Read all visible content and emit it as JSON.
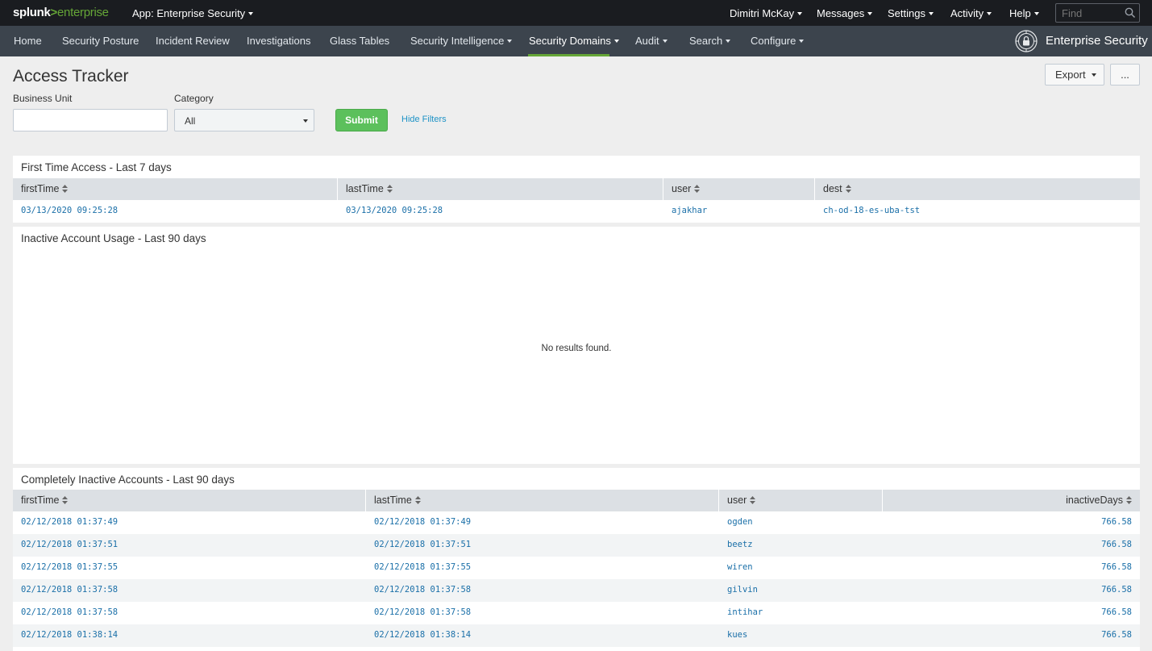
{
  "topbar": {
    "logo_splunk": "splunk",
    "logo_gt": ">",
    "logo_enterprise": "enterprise",
    "app_label": "App: Enterprise Security",
    "menus": [
      "Dimitri McKay",
      "Messages",
      "Settings",
      "Activity",
      "Help"
    ],
    "find_placeholder": "Find"
  },
  "nav": {
    "items": [
      "Home",
      "Security Posture",
      "Incident Review",
      "Investigations",
      "Glass Tables",
      "Security Intelligence",
      "Security Domains",
      "Audit",
      "Search",
      "Configure"
    ],
    "active": "Security Domains",
    "brand": "Enterprise Security"
  },
  "page": {
    "title": "Access Tracker",
    "export_label": "Export",
    "more_label": "..."
  },
  "filters": {
    "business_unit_label": "Business Unit",
    "business_unit_value": "",
    "category_label": "Category",
    "category_value": "All",
    "submit_label": "Submit",
    "hide_filters_label": "Hide Filters"
  },
  "panel1": {
    "title": "First Time Access - Last 7 days",
    "columns": [
      "firstTime",
      "lastTime",
      "user",
      "dest"
    ],
    "rows": [
      [
        "03/13/2020 09:25:28",
        "03/13/2020 09:25:28",
        "ajakhar",
        "ch-od-18-es-uba-tst"
      ]
    ]
  },
  "panel2": {
    "title": "Inactive Account Usage - Last 90 days",
    "message": "No results found."
  },
  "panel3": {
    "title": "Completely Inactive Accounts - Last 90 days",
    "columns": [
      "firstTime",
      "lastTime",
      "user",
      "inactiveDays"
    ],
    "rows": [
      [
        "02/12/2018 01:37:49",
        "02/12/2018 01:37:49",
        "ogden",
        "766.58"
      ],
      [
        "02/12/2018 01:37:51",
        "02/12/2018 01:37:51",
        "beetz",
        "766.58"
      ],
      [
        "02/12/2018 01:37:55",
        "02/12/2018 01:37:55",
        "wiren",
        "766.58"
      ],
      [
        "02/12/2018 01:37:58",
        "02/12/2018 01:37:58",
        "gilvin",
        "766.58"
      ],
      [
        "02/12/2018 01:37:58",
        "02/12/2018 01:37:58",
        "intihar",
        "766.58"
      ],
      [
        "02/12/2018 01:38:14",
        "02/12/2018 01:38:14",
        "kues",
        "766.58"
      ]
    ]
  },
  "colors": {
    "topbar_bg": "#1a1c20",
    "navbar_bg": "#3c444d",
    "accent_green": "#65a637",
    "submit_green": "#5cc05c",
    "link_blue": "#1a6fa8"
  },
  "icons": {
    "find": "search-icon",
    "sort": "sort-icon",
    "brand": "lock-target-icon"
  }
}
